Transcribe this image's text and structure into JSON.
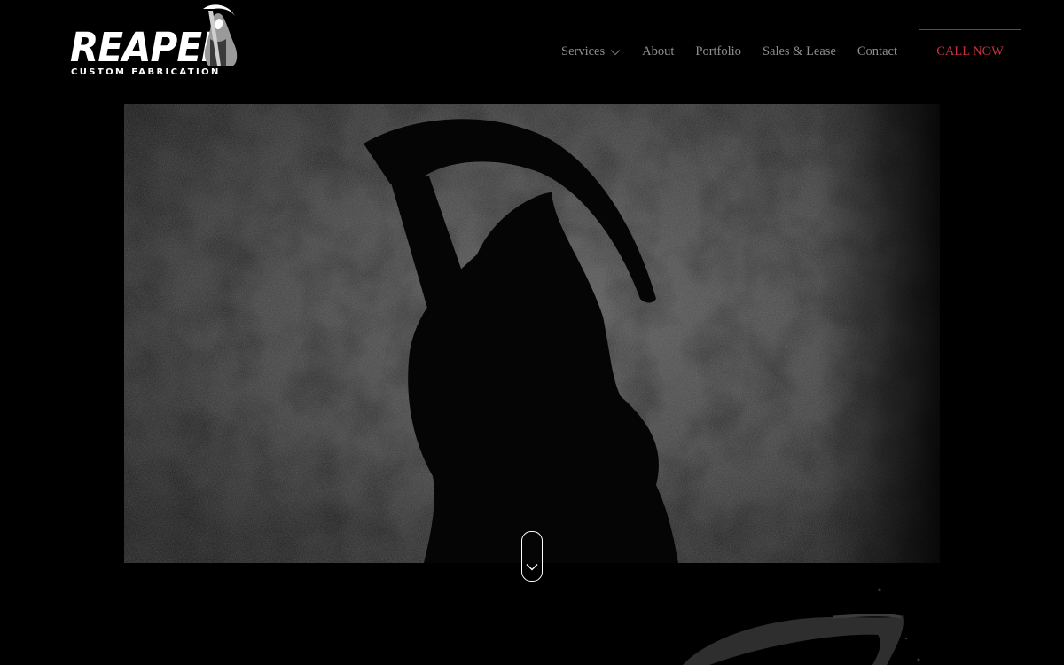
{
  "brand": {
    "word": "REAPER",
    "subline": "CUSTOM FABRICATION",
    "logo_icon": "grim-reaper-icon"
  },
  "nav": {
    "items": [
      {
        "label": "Services",
        "has_dropdown": true
      },
      {
        "label": "About"
      },
      {
        "label": "Portfolio"
      },
      {
        "label": "Sales & Lease"
      },
      {
        "label": "Contact"
      }
    ],
    "cta_label": "CALL NOW"
  },
  "hero": {
    "image": "reaper-silhouette-on-concrete",
    "scroll_icon": "chevron-down-icon"
  },
  "colors": {
    "background": "#000000",
    "nav_text": "#8e8e8e",
    "accent": "#c8323c",
    "white": "#ffffff"
  }
}
